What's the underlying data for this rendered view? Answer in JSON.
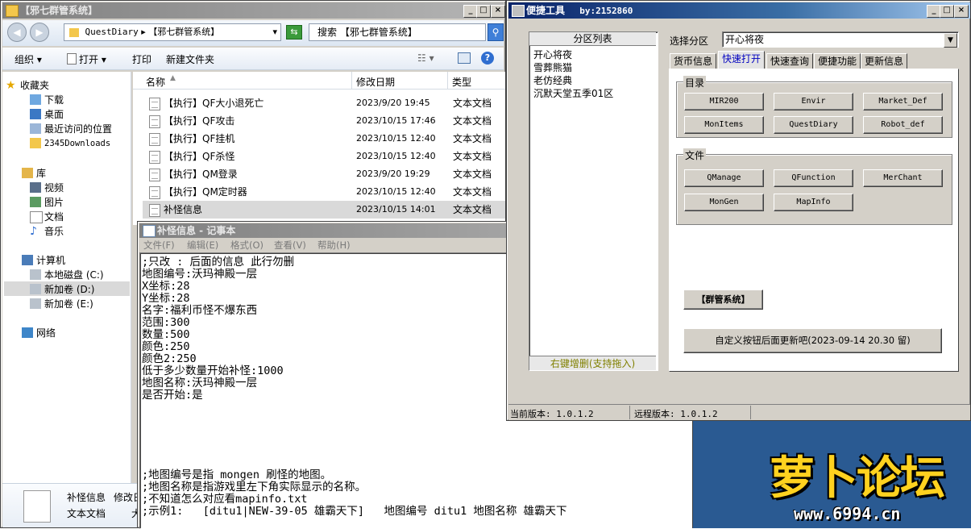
{
  "explorer": {
    "title": "【邪七群管系统】",
    "address": [
      "QuestDiary",
      "【邪七群管系统】"
    ],
    "search_placeholder": "搜索 【邪七群管系统】",
    "toolbar": [
      "组织",
      "打开",
      "打印",
      "新建文件夹"
    ],
    "columns": {
      "name": "名称",
      "date": "修改日期",
      "type": "类型"
    },
    "nav": {
      "favorites": "收藏夹",
      "fav_items": [
        "下载",
        "桌面",
        "最近访问的位置",
        "2345Downloads"
      ],
      "library": "库",
      "lib_items": [
        "视频",
        "图片",
        "文档",
        "音乐"
      ],
      "computer": "计算机",
      "drives": [
        "本地磁盘 (C:)",
        "新加卷 (D:)",
        "新加卷 (E:)"
      ],
      "network": "网络"
    },
    "files": [
      {
        "name": "【执行】QF大小退死亡",
        "date": "2023/9/20 19:45",
        "type": "文本文档"
      },
      {
        "name": "【执行】QF攻击",
        "date": "2023/10/15 17:46",
        "type": "文本文档"
      },
      {
        "name": "【执行】QF挂机",
        "date": "2023/10/15 12:40",
        "type": "文本文档"
      },
      {
        "name": "【执行】QF杀怪",
        "date": "2023/10/15 12:40",
        "type": "文本文档"
      },
      {
        "name": "【执行】QM登录",
        "date": "2023/9/20 19:29",
        "type": "文本文档"
      },
      {
        "name": "【执行】QM定时器",
        "date": "2023/10/15 12:40",
        "type": "文本文档"
      },
      {
        "name": "补怪信息",
        "date": "2023/10/15 14:01",
        "type": "文本文档"
      }
    ],
    "details": {
      "name": "补怪信息",
      "modified_label": "修改日",
      "type": "文本文档",
      "extra": "大"
    }
  },
  "notepad": {
    "title": "补怪信息 - 记事本",
    "menu": [
      "文件(F)",
      "编辑(E)",
      "格式(O)",
      "查看(V)",
      "帮助(H)"
    ],
    "lines": [
      ";只改 : 后面的信息 此行勿删",
      "地图编号:沃玛神殿一层",
      "X坐标:28",
      "Y坐标:28",
      "名字:福利币怪不爆东西",
      "范围:300",
      "数量:500",
      "颜色:250",
      "颜色2:250",
      "低于多少数量开始补怪:1000",
      "地图名称:沃玛神殿一层",
      "是否开始:是"
    ],
    "lines_bottom": [
      ";地图编号是指 mongen 刷怪的地图。",
      ";地图名称是指游戏里左下角实际显示的名称。",
      ";不知道怎么对应看mapinfo.txt",
      ";示例1:   [ditu1|NEW-39-05 雄霸天下]   地图编号 ditu1 地图名称 雄霸天下"
    ]
  },
  "tool": {
    "title": "便捷工具",
    "by": "by:2152860",
    "zone_list_header": "分区列表",
    "zones": [
      "开心将夜",
      "雪葬熊猫",
      "老仿经典",
      "沉默天堂五季01区"
    ],
    "zone_footer": "右键增删(支持拖入)",
    "select_zone_label": "选择分区",
    "select_zone_value": "开心将夜",
    "tabs": [
      "货币信息",
      "快速打开",
      "快速查询",
      "便捷功能",
      "更新信息"
    ],
    "active_tab": "快速打开",
    "dir_group": "目录",
    "dir_buttons": [
      "MIR200",
      "Envir",
      "Market_Def",
      "MonItems",
      "QuestDiary",
      "Robot_def"
    ],
    "file_group": "文件",
    "file_buttons": [
      "QManage",
      "QFunction",
      "MerChant",
      "MonGen",
      "MapInfo"
    ],
    "group_button": "【群管系统】",
    "custom_button": "自定义按钮后面更新吧(2023-09-14 20.30 留)",
    "status": {
      "current": "当前版本: 1.0.1.2",
      "remote": "远程版本: 1.0.1.2"
    }
  },
  "watermark": {
    "text": "萝卜论坛",
    "url": "www.6994.cn"
  }
}
